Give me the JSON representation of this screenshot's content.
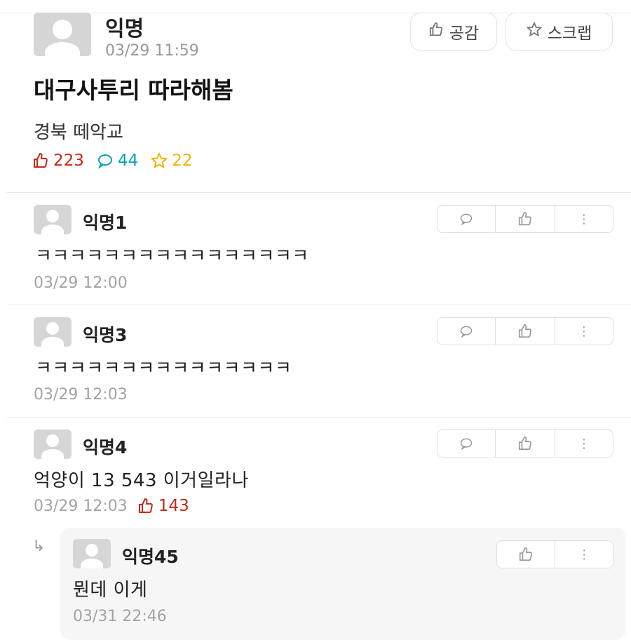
{
  "post": {
    "author": "익명",
    "time": "03/29 11:59",
    "like_button": "공감",
    "scrap_button": "스크랩",
    "title": "대구사투리 따라해봄",
    "body": "경북 떼악교",
    "likes": "223",
    "comments": "44",
    "scraps": "22"
  },
  "comments": [
    {
      "author": "익명1",
      "text": "ㅋㅋㅋㅋㅋㅋㅋㅋㅋㅋㅋㅋㅋㅋㅋㅋ",
      "time": "03/29 12:00"
    },
    {
      "author": "익명3",
      "text": "ㅋㅋㅋㅋㅋㅋㅋㅋㅋㅋㅋㅋㅋㅋㅋ",
      "time": "03/29 12:03"
    },
    {
      "author": "익명4",
      "text": "억양이 13 543 이거일라나",
      "time": "03/29 12:03",
      "votes": "143"
    }
  ],
  "reply": {
    "author": "익명45",
    "text": "뭔데 이게",
    "time": "03/31 22:46"
  },
  "colors": {
    "like": "#c62917",
    "comment": "#0aa3b8",
    "scrap": "#f0b400",
    "muted": "#a3a3a3"
  }
}
